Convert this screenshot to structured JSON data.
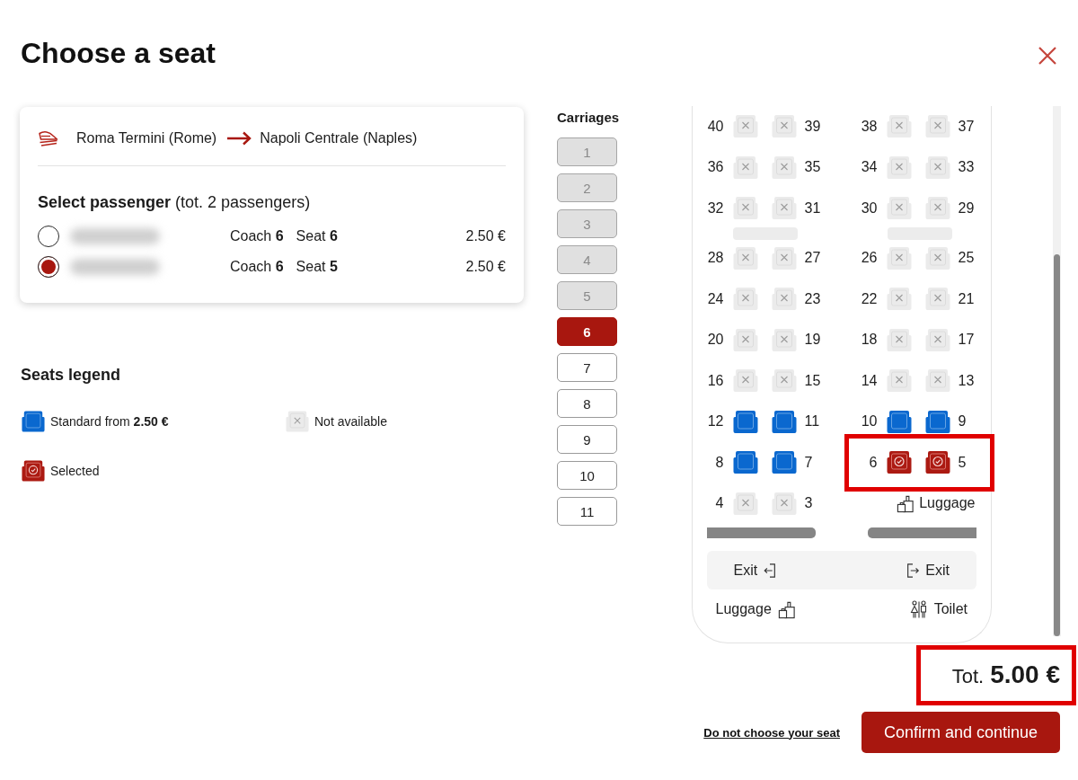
{
  "title": "Choose a seat",
  "journey": {
    "origin": "Roma Termini (Rome)",
    "destination": "Napoli Centrale (Naples)"
  },
  "passengers": {
    "heading": "**Select passenger** (tot. 2 passengers)",
    "items": [
      {
        "selected": false,
        "coach": "Coach **6**",
        "seat": "Seat **6**",
        "price": "2.50 €"
      },
      {
        "selected": true,
        "coach": "Coach **6**",
        "seat": "Seat **5**",
        "price": "2.50 €"
      }
    ]
  },
  "legend": {
    "title": "Seats legend",
    "items": [
      {
        "kind": "available",
        "label": "Standard from **2.50 €**"
      },
      {
        "kind": "unavailable",
        "label": "Not available"
      },
      {
        "kind": "selected",
        "label": "Selected"
      }
    ]
  },
  "carriages": {
    "title": "Carriages",
    "items": [
      {
        "label": "1",
        "disabled": true,
        "selected": false
      },
      {
        "label": "2",
        "disabled": true,
        "selected": false
      },
      {
        "label": "3",
        "disabled": true,
        "selected": false
      },
      {
        "label": "4",
        "disabled": true,
        "selected": false
      },
      {
        "label": "5",
        "disabled": true,
        "selected": false
      },
      {
        "label": "6",
        "disabled": false,
        "selected": true
      },
      {
        "label": "7",
        "disabled": false,
        "selected": false
      },
      {
        "label": "8",
        "disabled": false,
        "selected": false
      },
      {
        "label": "9",
        "disabled": false,
        "selected": false
      },
      {
        "label": "10",
        "disabled": false,
        "selected": false
      },
      {
        "label": "11",
        "disabled": false,
        "selected": false
      }
    ]
  },
  "seat_map": {
    "rows": [
      {
        "kind": "seats",
        "left": {
          "kind": "pair",
          "highlighted": false,
          "seats": [
            {
              "number": "40",
              "disabled": true,
              "selected": false
            },
            {
              "number": "39",
              "disabled": true,
              "selected": false
            }
          ]
        },
        "right": {
          "kind": "pair",
          "highlighted": false,
          "seats": [
            {
              "number": "38",
              "disabled": true,
              "selected": false
            },
            {
              "number": "37",
              "disabled": true,
              "selected": false
            }
          ]
        }
      },
      {
        "kind": "seats",
        "left": {
          "kind": "pair",
          "highlighted": false,
          "seats": [
            {
              "number": "36",
              "disabled": true,
              "selected": false
            },
            {
              "number": "35",
              "disabled": true,
              "selected": false
            }
          ]
        },
        "right": {
          "kind": "pair",
          "highlighted": false,
          "seats": [
            {
              "number": "34",
              "disabled": true,
              "selected": false
            },
            {
              "number": "33",
              "disabled": true,
              "selected": false
            }
          ]
        }
      },
      {
        "kind": "seats",
        "left": {
          "kind": "pair",
          "highlighted": false,
          "seats": [
            {
              "number": "32",
              "disabled": true,
              "selected": false
            },
            {
              "number": "31",
              "disabled": true,
              "selected": false
            }
          ]
        },
        "right": {
          "kind": "pair",
          "highlighted": false,
          "seats": [
            {
              "number": "30",
              "disabled": true,
              "selected": false
            },
            {
              "number": "29",
              "disabled": true,
              "selected": false
            }
          ]
        }
      },
      {
        "kind": "tables"
      },
      {
        "kind": "seats",
        "left": {
          "kind": "pair",
          "highlighted": false,
          "seats": [
            {
              "number": "28",
              "disabled": true,
              "selected": false
            },
            {
              "number": "27",
              "disabled": true,
              "selected": false
            }
          ]
        },
        "right": {
          "kind": "pair",
          "highlighted": false,
          "seats": [
            {
              "number": "26",
              "disabled": true,
              "selected": false
            },
            {
              "number": "25",
              "disabled": true,
              "selected": false
            }
          ]
        }
      },
      {
        "kind": "seats",
        "left": {
          "kind": "pair",
          "highlighted": false,
          "seats": [
            {
              "number": "24",
              "disabled": true,
              "selected": false
            },
            {
              "number": "23",
              "disabled": true,
              "selected": false
            }
          ]
        },
        "right": {
          "kind": "pair",
          "highlighted": false,
          "seats": [
            {
              "number": "22",
              "disabled": true,
              "selected": false
            },
            {
              "number": "21",
              "disabled": true,
              "selected": false
            }
          ]
        }
      },
      {
        "kind": "seats",
        "left": {
          "kind": "pair",
          "highlighted": false,
          "seats": [
            {
              "number": "20",
              "disabled": true,
              "selected": false
            },
            {
              "number": "19",
              "disabled": true,
              "selected": false
            }
          ]
        },
        "right": {
          "kind": "pair",
          "highlighted": false,
          "seats": [
            {
              "number": "18",
              "disabled": true,
              "selected": false
            },
            {
              "number": "17",
              "disabled": true,
              "selected": false
            }
          ]
        }
      },
      {
        "kind": "seats",
        "left": {
          "kind": "pair",
          "highlighted": false,
          "seats": [
            {
              "number": "16",
              "disabled": true,
              "selected": false
            },
            {
              "number": "15",
              "disabled": true,
              "selected": false
            }
          ]
        },
        "right": {
          "kind": "pair",
          "highlighted": false,
          "seats": [
            {
              "number": "14",
              "disabled": true,
              "selected": false
            },
            {
              "number": "13",
              "disabled": true,
              "selected": false
            }
          ]
        }
      },
      {
        "kind": "seats",
        "left": {
          "kind": "pair",
          "highlighted": false,
          "seats": [
            {
              "number": "12",
              "disabled": false,
              "selected": false
            },
            {
              "number": "11",
              "disabled": false,
              "selected": false
            }
          ]
        },
        "right": {
          "kind": "pair",
          "highlighted": false,
          "seats": [
            {
              "number": "10",
              "disabled": false,
              "selected": false
            },
            {
              "number": "9",
              "disabled": false,
              "selected": false
            }
          ]
        }
      },
      {
        "kind": "seats",
        "left": {
          "kind": "pair",
          "highlighted": false,
          "seats": [
            {
              "number": "8",
              "disabled": false,
              "selected": false
            },
            {
              "number": "7",
              "disabled": false,
              "selected": false
            }
          ]
        },
        "right": {
          "kind": "pair",
          "highlighted": true,
          "seats": [
            {
              "number": "6",
              "disabled": false,
              "selected": true
            },
            {
              "number": "5",
              "disabled": false,
              "selected": true
            }
          ]
        }
      },
      {
        "kind": "seats",
        "left": {
          "kind": "pair",
          "highlighted": false,
          "seats": [
            {
              "number": "4",
              "disabled": true,
              "selected": false
            },
            {
              "number": "3",
              "disabled": true,
              "selected": false
            }
          ]
        },
        "right": {
          "kind": "luggage",
          "highlighted": false,
          "label": "Luggage"
        }
      },
      {
        "kind": "partition"
      }
    ],
    "exits": [
      {
        "label": "Exit"
      },
      {
        "label": "Exit"
      }
    ],
    "facilities": [
      {
        "kind": "luggage",
        "label": "Luggage"
      },
      {
        "kind": "toilet",
        "label": "Toilet"
      }
    ]
  },
  "total": {
    "label": "Tot.",
    "amount": "5.00 €",
    "highlighted": true
  },
  "footer": {
    "skip_link": "Do not choose your seat",
    "confirm_button": "Confirm and continue"
  }
}
